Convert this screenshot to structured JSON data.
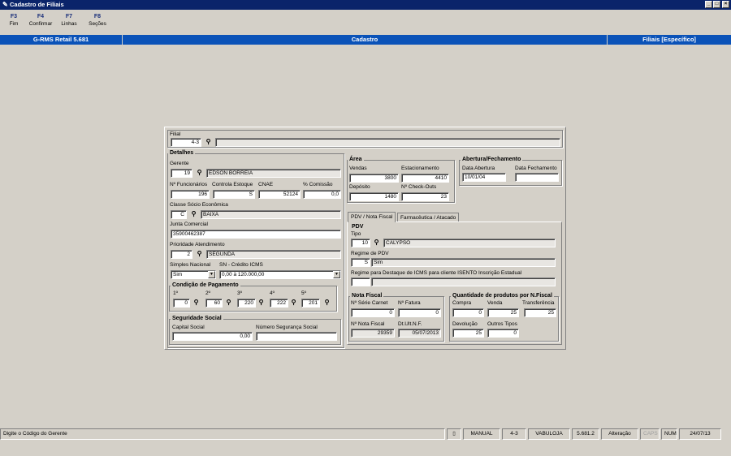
{
  "window": {
    "title": "Cadastro de Filiais",
    "min": "_",
    "max": "□",
    "close": "×"
  },
  "toolbar": [
    {
      "key": "F3",
      "label": "Fim"
    },
    {
      "key": "F4",
      "label": "Confirmar"
    },
    {
      "key": "F7",
      "label": "Linhas"
    },
    {
      "key": "F8",
      "label": "Seções"
    }
  ],
  "header": {
    "app": "G-RMS Retail 5.681",
    "section": "Cadastro",
    "mode": "Filiais [Específico]"
  },
  "filial": {
    "label": "Filial",
    "code": "4-3",
    "name": ""
  },
  "detalhes": {
    "title": "Detalhes",
    "gerente_label": "Gerente",
    "gerente_code": "19",
    "gerente_name": "EDSON BORREIA",
    "funcionarios_label": "Nº Funcionários",
    "funcionarios": "196",
    "controla_label": "Controla Estoque",
    "controla": "S",
    "cnae_label": "CNAE",
    "cnae": "52124",
    "comissao_label": "% Comissão",
    "comissao": "0,0",
    "classe_label": "Classe Sócio Econômica",
    "classe_code": "C",
    "classe_name": "BAIXA",
    "junta_label": "Junta Comercial",
    "junta": "35900462387",
    "prioridade_label": "Prioridade Atendimento",
    "prioridade_code": "2",
    "prioridade_name": "SEGUNDA",
    "simples_label": "Simples Nacional",
    "simples": "Sim",
    "sn_label": "SN - Crédito ICMS",
    "sn": "0,00 à 120.000,00"
  },
  "condicao": {
    "title": "Condição de Pagamento",
    "items": [
      {
        "label": "1º",
        "value": "0"
      },
      {
        "label": "2º",
        "value": "60"
      },
      {
        "label": "3º",
        "value": "220"
      },
      {
        "label": "4º",
        "value": "222"
      },
      {
        "label": "5º",
        "value": "201"
      }
    ]
  },
  "seguridade": {
    "title": "Seguridade Social",
    "capital_label": "Capital Social",
    "capital": "0,00",
    "numero_label": "Número Segurança Social",
    "numero": ""
  },
  "area": {
    "title": "Área",
    "vendas_label": "Vendas",
    "vendas": "3800",
    "estac_label": "Estacionamento",
    "estac": "4410",
    "deposito_label": "Depósito",
    "deposito": "1480",
    "checkouts_label": "Nº Check-Outs",
    "checkouts": "23"
  },
  "abertura": {
    "title": "Abertura/Fechamento",
    "abertura_label": "Data Abertura",
    "abertura": "10/01/04",
    "fechamento_label": "Data Fechamento",
    "fechamento": ""
  },
  "tabs": [
    "PDV / Nota Fiscal",
    "Farmacêutica / Atacado"
  ],
  "pdv": {
    "title": "PDV",
    "tipo_label": "Tipo",
    "tipo_code": "10",
    "tipo_name": "CALYPSO",
    "regime_label": "Regime de PDV",
    "regime_code": "S",
    "regime_name": "Sim",
    "destaque_label": "Regime para Destaque de ICMS para cliente ISENTO Inscrição Estadual",
    "destaque": ""
  },
  "nota": {
    "title": "Nota Fiscal",
    "serie_label": "Nº Série Carnet",
    "serie": "0",
    "fatura_label": "Nº Fatura",
    "fatura": "0",
    "nf_label": "Nº Nota Fiscal",
    "nf": "29359",
    "dt_label": "Dt.Ult.N.F.",
    "dt": "05/07/2013"
  },
  "qtd": {
    "title": "Quantidade de produtos por N.Fiscal",
    "compra_label": "Compra",
    "compra": "0",
    "venda_label": "Venda",
    "venda": "25",
    "transf_label": "Transferência",
    "transf": "25",
    "devol_label": "Devolução",
    "devol": "25",
    "outros_label": "Outros Tipos",
    "outros": "0"
  },
  "statusbar": {
    "hint": "Digite o Código do Gerente",
    "mode": "MANUAL",
    "filial": "4-3",
    "db": "VABULOJA",
    "version": "5.681.2",
    "action": "Alteração",
    "caps": "CAPS",
    "num": "NUM",
    "date": "24/07/13"
  }
}
